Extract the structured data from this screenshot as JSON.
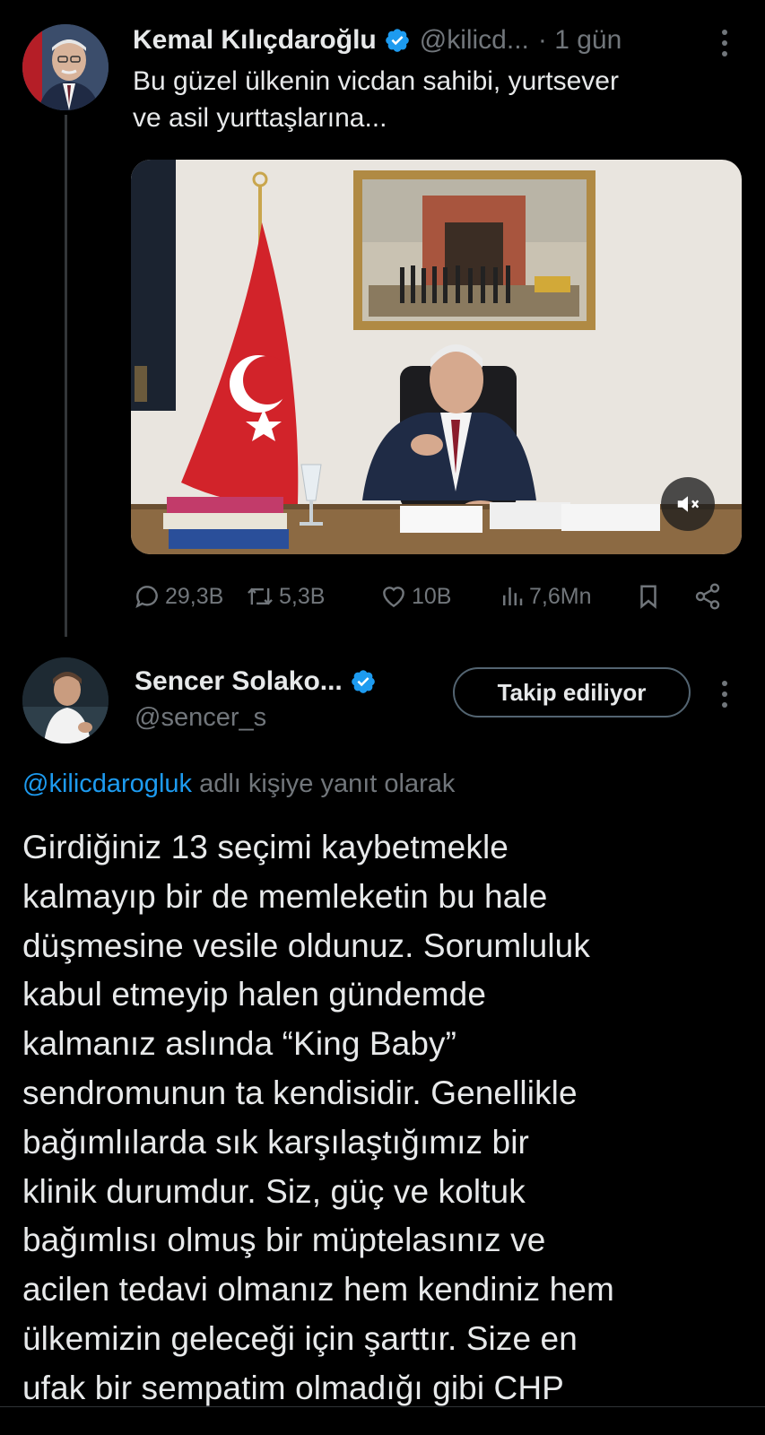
{
  "parent_tweet": {
    "author_name": "Kemal Kılıçdaroğlu",
    "handle": "@kilicd...",
    "time": "· 1 gün",
    "text_lines": [
      "Bu güzel ülkenin vicdan sahibi, yurtsever",
      "ve asil yurttaşlarına..."
    ],
    "video": {
      "muted_icon": "speaker-muted-icon"
    },
    "stats": {
      "replies": "29,3B",
      "reposts": "5,3B",
      "likes": "10B",
      "views": "7,6Mn"
    }
  },
  "reply_tweet": {
    "author_name": "Sencer Solako...",
    "handle": "@sencer_s",
    "follow_label": "Takip ediliyor",
    "reply_to": {
      "mention": "@kilicdarogluk",
      "suffix": " adlı kişiye yanıt olarak"
    },
    "text_lines": [
      "Girdiğiniz 13 seçimi kaybetmekle",
      "kalmayıp bir de memleketin bu hale",
      "düşmesine vesile oldunuz. Sorumluluk",
      "kabul etmeyip halen gündemde",
      "kalmanız aslında “King Baby”",
      "sendromunun ta kendisidir. Genellikle",
      "bağımlılarda sık karşılaştığımız bir",
      "klinik durumdur. Siz, güç ve koltuk",
      "bağımlısı olmuş bir müptelasınız ve",
      "acilen tedavi olmanız hem kendiniz hem",
      "ülkemizin geleceği için şarttır. Size en",
      "ufak bir sempatim olmadığı gibi CHP"
    ]
  },
  "colors": {
    "background": "#000000",
    "primary_text": "#e7e9ea",
    "secondary_text": "#71767b",
    "accent": "#1d9bf0",
    "verified_badge": "#1d9bf0"
  }
}
